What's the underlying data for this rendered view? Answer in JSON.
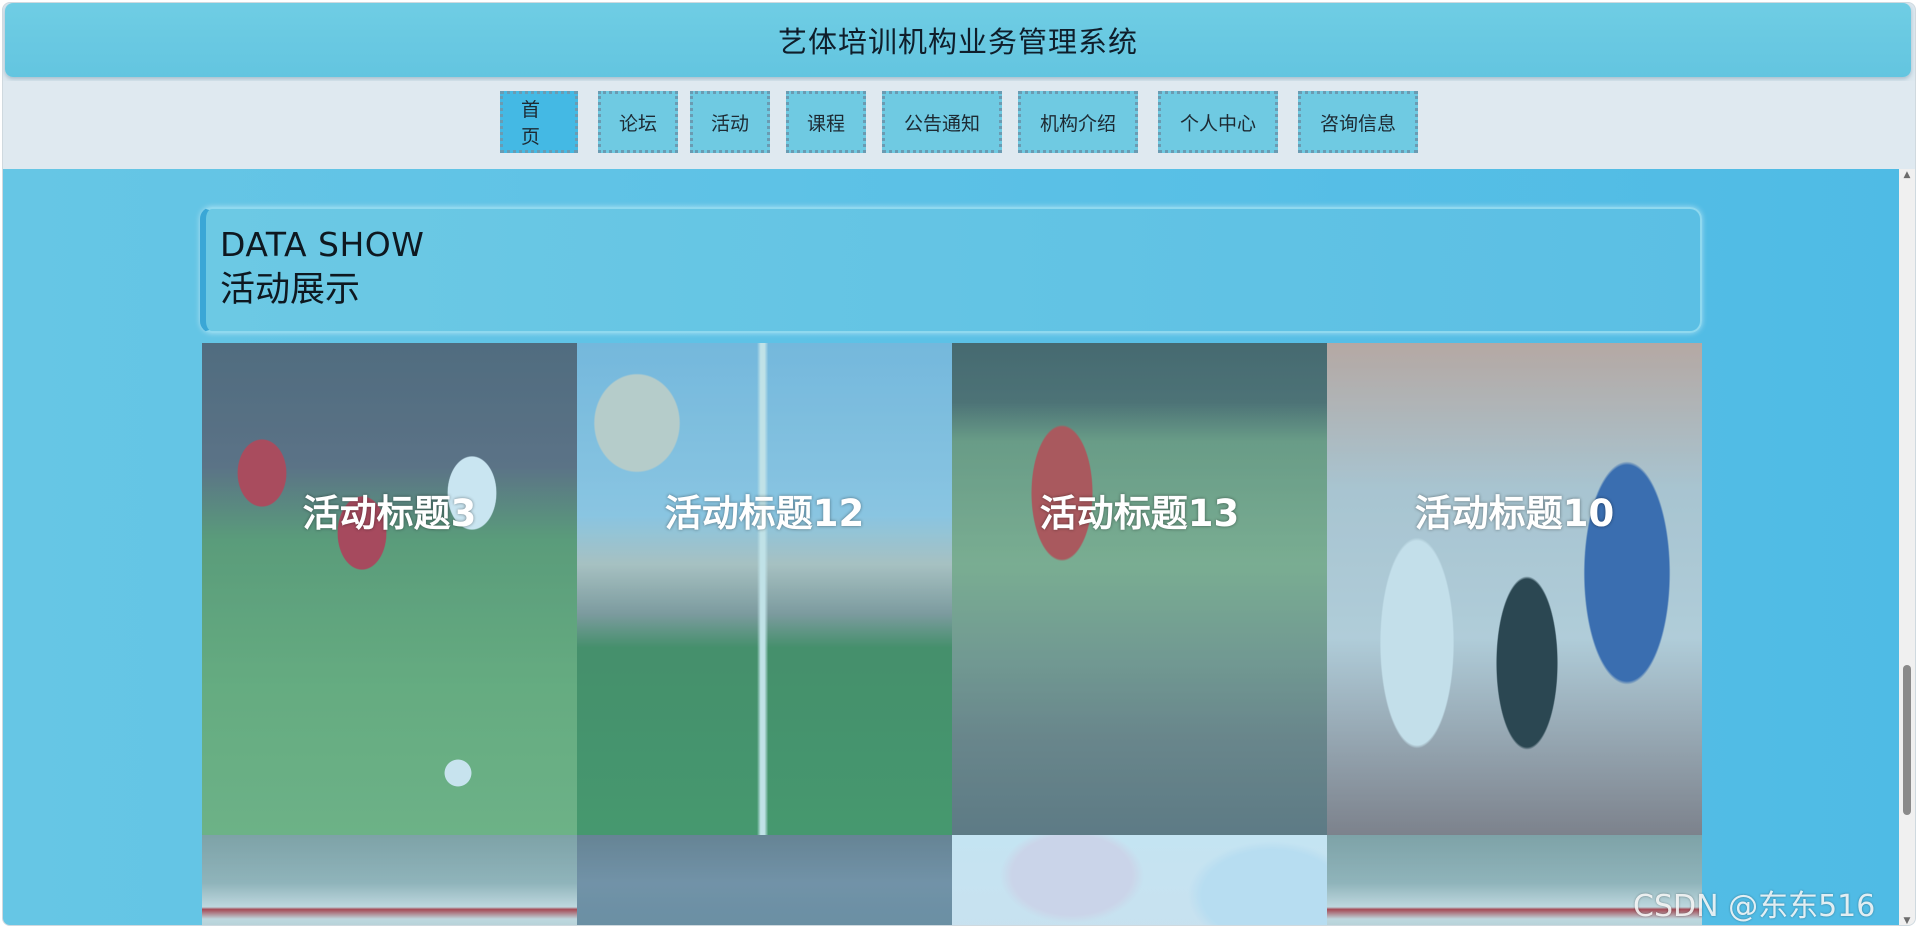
{
  "header": {
    "title": "艺体培训机构业务管理系统"
  },
  "nav": {
    "items": [
      {
        "label": "首页",
        "active": true
      },
      {
        "label": "论坛",
        "active": false
      },
      {
        "label": "活动",
        "active": false
      },
      {
        "label": "课程",
        "active": false
      },
      {
        "label": "公告通知",
        "active": false
      },
      {
        "label": "机构介绍",
        "active": false
      },
      {
        "label": "个人中心",
        "active": false
      },
      {
        "label": "咨询信息",
        "active": false
      }
    ]
  },
  "section": {
    "title_en": "DATA SHOW",
    "title_cn": "活动展示"
  },
  "gallery": {
    "cards": [
      {
        "title": "活动标题3",
        "image": "soccer-youth-match"
      },
      {
        "title": "活动标题12",
        "image": "school-football-field"
      },
      {
        "title": "活动标题13",
        "image": "group-photo-with-flag"
      },
      {
        "title": "活动标题10",
        "image": "students-at-booth"
      },
      {
        "title": "",
        "image": "school-building-banner"
      },
      {
        "title": "",
        "image": "soccer-crowd"
      },
      {
        "title": "",
        "image": "pastel-illustration"
      },
      {
        "title": "",
        "image": "school-building-banner"
      }
    ]
  },
  "watermark": "CSDN @东东516",
  "colors": {
    "title_bar": "#6fcde4",
    "nav_bg": "#dfe9f0",
    "nav_item": "#6fcae2",
    "nav_active": "#44b9e4",
    "content_bg": "#5ec2e6"
  }
}
